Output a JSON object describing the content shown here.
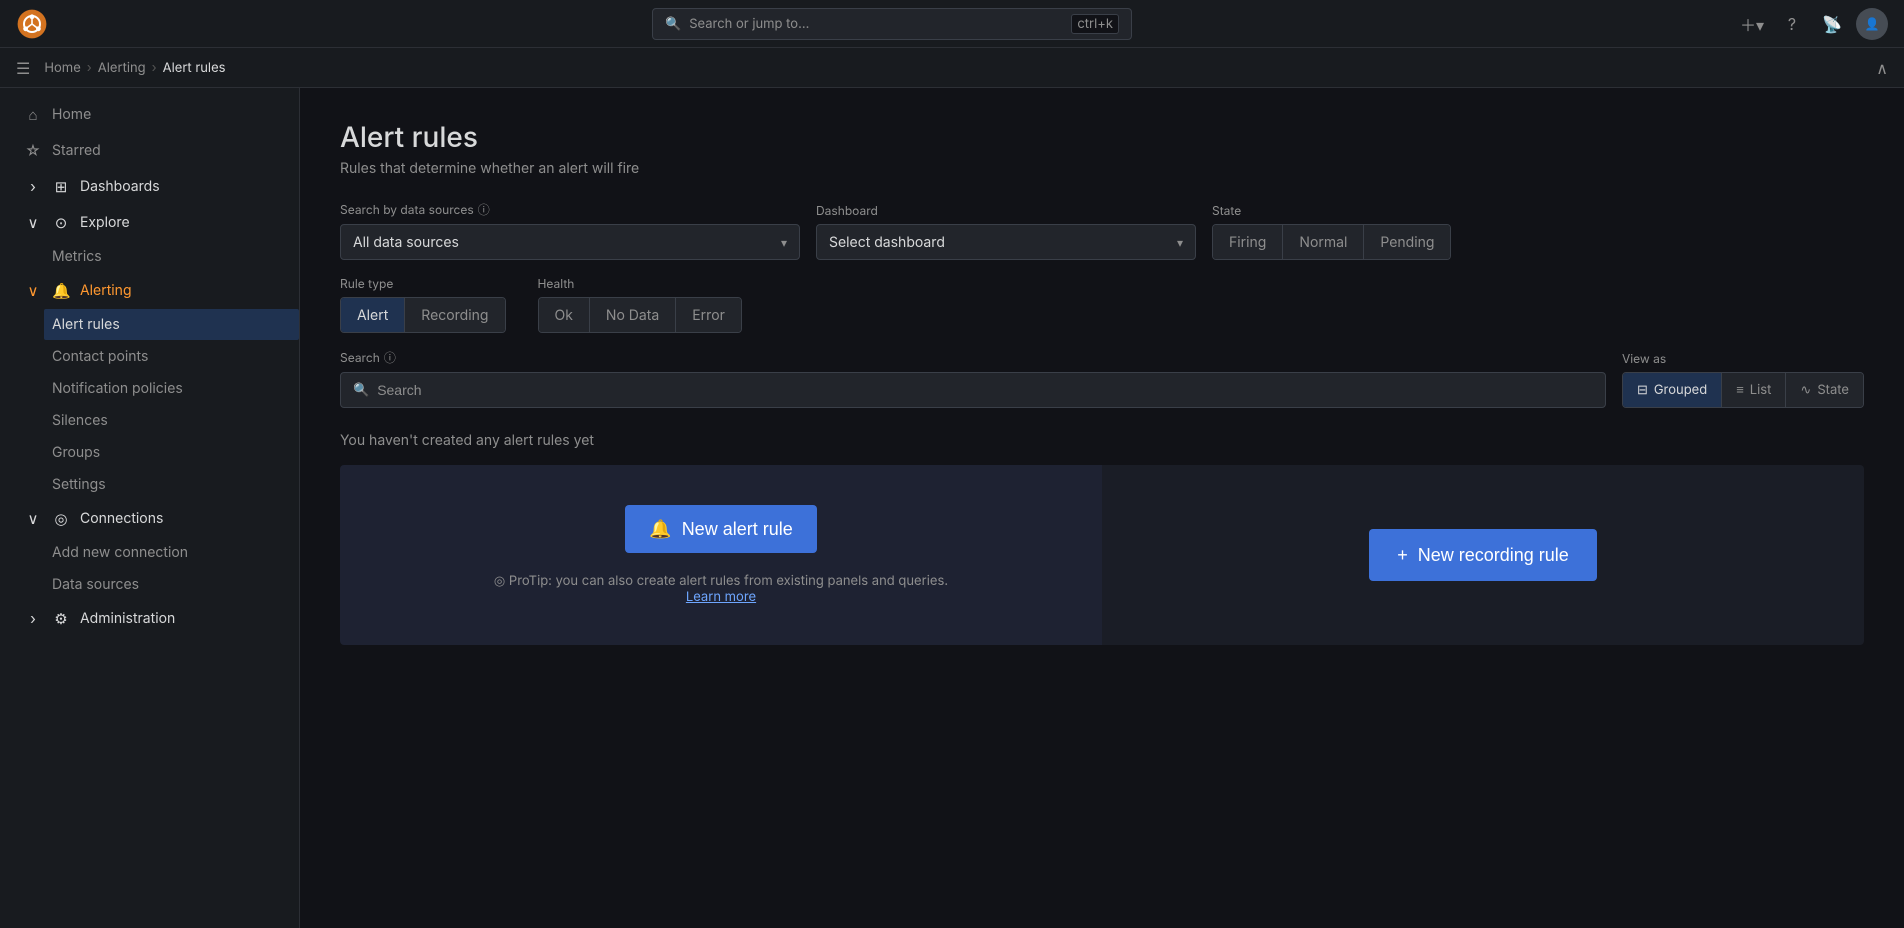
{
  "app": {
    "logo_alt": "Grafana logo"
  },
  "topbar": {
    "search_placeholder": "Search or jump to...",
    "search_shortcut": "ctrl+k",
    "add_icon_label": "+",
    "help_icon_label": "?",
    "rss_icon_label": "RSS",
    "avatar_label": "User avatar"
  },
  "breadcrumb": {
    "menu_icon": "☰",
    "home": "Home",
    "alerting": "Alerting",
    "current": "Alert rules",
    "collapse_icon": "∧"
  },
  "sidebar": {
    "items": [
      {
        "id": "home",
        "icon": "⌂",
        "label": "Home",
        "active": false
      },
      {
        "id": "starred",
        "icon": "☆",
        "label": "Starred",
        "active": false
      },
      {
        "id": "dashboards",
        "icon": "⊞",
        "label": "Dashboards",
        "active": false
      },
      {
        "id": "explore",
        "icon": "⊙",
        "label": "Explore",
        "active": false
      },
      {
        "id": "metrics",
        "label": "Metrics",
        "sub": true,
        "active": false
      },
      {
        "id": "alerting",
        "icon": "🔔",
        "label": "Alerting",
        "active": true
      },
      {
        "id": "alert-rules",
        "label": "Alert rules",
        "sub": true,
        "active": true
      },
      {
        "id": "contact-points",
        "label": "Contact points",
        "sub": true,
        "active": false
      },
      {
        "id": "notification-policies",
        "label": "Notification policies",
        "sub": true,
        "active": false
      },
      {
        "id": "silences",
        "label": "Silences",
        "sub": true,
        "active": false
      },
      {
        "id": "groups",
        "label": "Groups",
        "sub": true,
        "active": false
      },
      {
        "id": "settings",
        "label": "Settings",
        "sub": true,
        "active": false
      },
      {
        "id": "connections",
        "icon": "◎",
        "label": "Connections",
        "active": false
      },
      {
        "id": "add-new-connection",
        "label": "Add new connection",
        "sub": true,
        "active": false
      },
      {
        "id": "data-sources",
        "label": "Data sources",
        "sub": true,
        "active": false
      },
      {
        "id": "administration",
        "icon": "⚙",
        "label": "Administration",
        "active": false
      }
    ]
  },
  "page": {
    "title": "Alert rules",
    "subtitle": "Rules that determine whether an alert will fire",
    "filter_datasources_label": "Search by data sources",
    "filter_datasources_placeholder": "All data sources",
    "filter_dashboard_label": "Dashboard",
    "filter_dashboard_placeholder": "Select dashboard",
    "filter_state_label": "State",
    "state_buttons": [
      "Firing",
      "Normal",
      "Pending"
    ],
    "rule_type_label": "Rule type",
    "rule_type_buttons": [
      {
        "id": "alert",
        "label": "Alert",
        "active": true
      },
      {
        "id": "recording",
        "label": "Recording",
        "active": false
      }
    ],
    "health_label": "Health",
    "health_buttons": [
      {
        "id": "ok",
        "label": "Ok",
        "active": false
      },
      {
        "id": "no-data",
        "label": "No Data",
        "active": false
      },
      {
        "id": "error",
        "label": "Error",
        "active": false
      }
    ],
    "search_label": "Search",
    "search_placeholder": "Search",
    "view_as_label": "View as",
    "view_as_buttons": [
      {
        "id": "grouped",
        "icon": "⊟",
        "label": "Grouped",
        "active": true
      },
      {
        "id": "list",
        "icon": "≡",
        "label": "List",
        "active": false
      },
      {
        "id": "state",
        "icon": "∿",
        "label": "State",
        "active": false
      }
    ],
    "empty_state_text": "You haven't created any alert rules yet",
    "new_alert_rule_label": "New alert rule",
    "new_alert_rule_icon": "🔔",
    "protip_text": "ProTip: you can also create alert rules from existing panels and queries.",
    "protip_link": "Learn more",
    "new_recording_rule_label": "New recording rule",
    "new_recording_rule_icon": "+"
  }
}
